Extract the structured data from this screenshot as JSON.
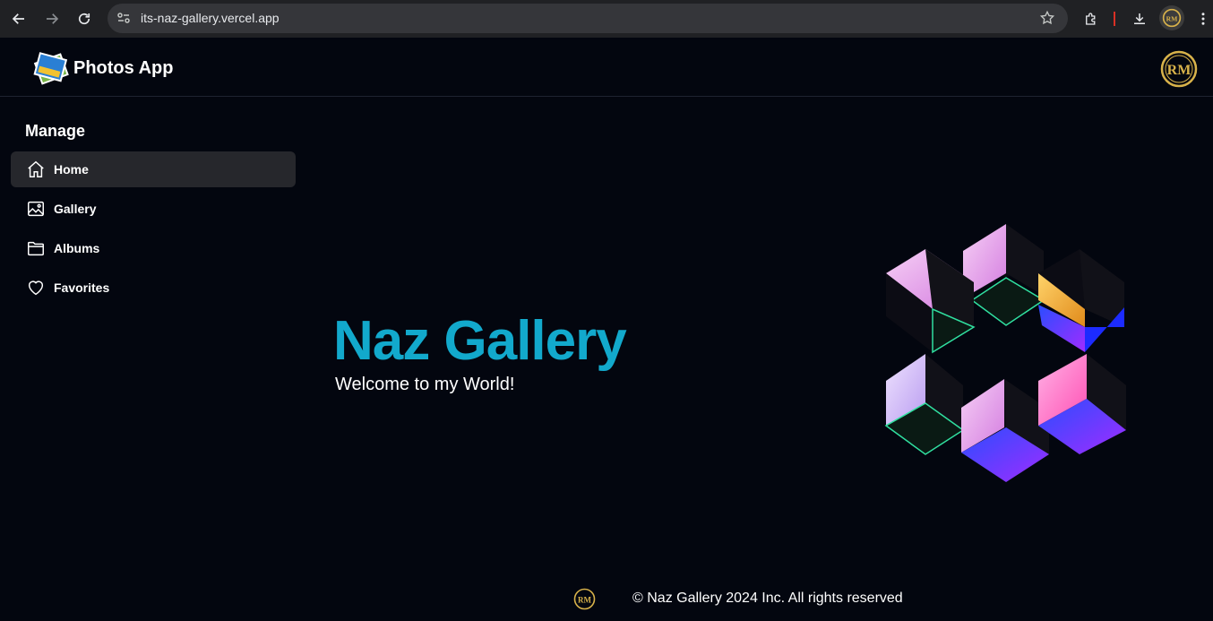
{
  "browser": {
    "url": "its-naz-gallery.vercel.app",
    "icons": [
      "back-icon",
      "forward-icon",
      "reload-icon",
      "site-info-icon",
      "bookmark-star-icon",
      "extensions-icon",
      "download-icon",
      "kebab-menu-icon"
    ]
  },
  "header": {
    "title": "Photos App"
  },
  "sidebar": {
    "heading": "Manage",
    "items": [
      {
        "label": "Home",
        "icon": "home-icon",
        "active": true
      },
      {
        "label": "Gallery",
        "icon": "image-icon",
        "active": false
      },
      {
        "label": "Albums",
        "icon": "folder-icon",
        "active": false
      },
      {
        "label": "Favorites",
        "icon": "heart-icon",
        "active": false
      }
    ]
  },
  "hero": {
    "title": "Naz Gallery",
    "subtitle": "Welcome to my World!"
  },
  "footer": {
    "text": "© Naz Gallery 2024 Inc. All rights reserved"
  },
  "colors": {
    "background": "#03060f",
    "accent": "#12a9cc",
    "active_item": "#26272c",
    "gold": "#d8b24a"
  }
}
